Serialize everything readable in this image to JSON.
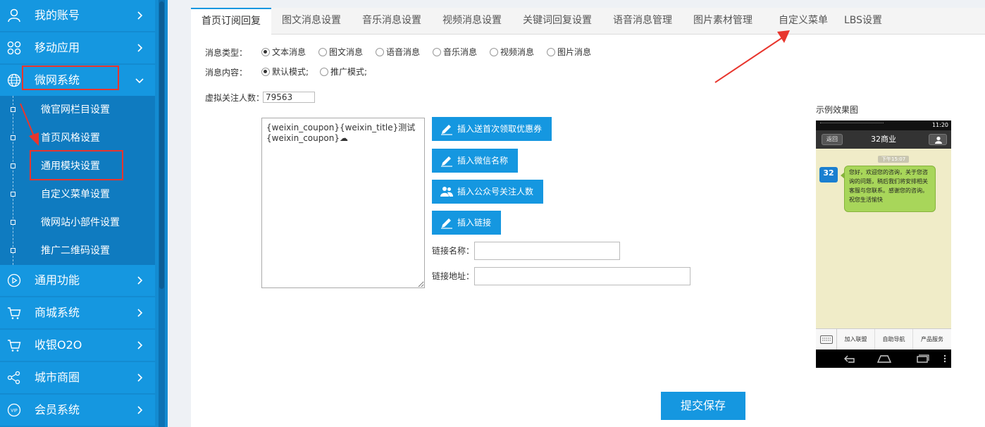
{
  "sidebar": {
    "items": [
      {
        "label": "我的账号",
        "icon": "user-icon"
      },
      {
        "label": "移动应用",
        "icon": "apps-icon"
      },
      {
        "label": "微网系统",
        "icon": "globe-icon",
        "expanded": true
      },
      {
        "label": "通用功能",
        "icon": "play-icon"
      },
      {
        "label": "商城系统",
        "icon": "cart-icon"
      },
      {
        "label": "收银O2O",
        "icon": "cart-icon"
      },
      {
        "label": "城市商圈",
        "icon": "share-icon"
      },
      {
        "label": "会员系统",
        "icon": "vip-icon"
      }
    ],
    "vip_badge": "VIP",
    "subitems": [
      {
        "label": "微官网栏目设置"
      },
      {
        "label": "首页风格设置"
      },
      {
        "label": "通用模块设置"
      },
      {
        "label": "自定义菜单设置"
      },
      {
        "label": "微网站小部件设置"
      },
      {
        "label": "推广二维码设置"
      }
    ]
  },
  "tabs": [
    {
      "label": "首页订阅回复",
      "active": true
    },
    {
      "label": "图文消息设置"
    },
    {
      "label": "音乐消息设置"
    },
    {
      "label": "视频消息设置"
    },
    {
      "label": "关键词回复设置"
    },
    {
      "label": "语音消息管理"
    },
    {
      "label": "图片素材管理"
    },
    {
      "label": "自定义菜单"
    },
    {
      "label": "LBS设置"
    }
  ],
  "form": {
    "msg_type_label": "消息类型：",
    "msg_types": [
      "文本消息",
      "图文消息",
      "语音消息",
      "音乐消息",
      "视频消息",
      "图片消息"
    ],
    "msg_type_selected": "文本消息",
    "msg_content_label": "消息内容：",
    "msg_content_modes": [
      "默认模式;",
      "推广模式;"
    ],
    "msg_content_selected": "默认模式;",
    "virtual_followers_label": "虚拟关注人数：",
    "virtual_followers_value": "79563",
    "message_text": "{weixin_coupon}{weixin_title}测试\n{weixin_coupon}☁",
    "buttons": {
      "insert_coupon": "插入送首次领取优惠券",
      "insert_wechat_name": "插入微信名称",
      "insert_follower_count": "插入公众号关注人数",
      "insert_link": "插入链接"
    },
    "link_name_label": "链接名称：",
    "link_name_value": "",
    "link_url_label": "链接地址：",
    "link_url_value": "",
    "save_label": "提交保存"
  },
  "preview": {
    "label": "示例效果图",
    "status_time": "11:20",
    "back_label": "返回",
    "title": "32商业",
    "time_stamp": "下午15:07",
    "avatar_text": "32",
    "bubble_text": "您好，欢迎您的咨询，关于您咨询的问题，稍后我们将安排相关客服与您联系。感谢您的咨询。祝您生活愉快",
    "menu": [
      "加入联盟",
      "自助导航",
      "产品服务"
    ]
  },
  "colors": {
    "sidebar_bg": "#1597e0",
    "submenu_bg": "#0f7bc0",
    "accent": "#1597e0",
    "annotation_red": "#e8352d"
  }
}
